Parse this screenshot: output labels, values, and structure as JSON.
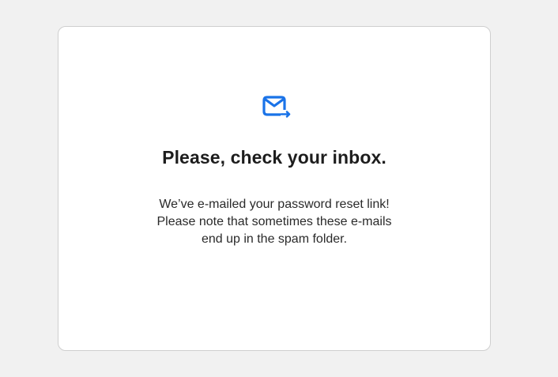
{
  "card": {
    "icon": "mail-forward-icon",
    "title": "Please, check your inbox.",
    "message_lines": [
      "We’ve e-mailed your password reset link!",
      "Please note that sometimes these e-mails",
      "end up in the spam folder."
    ]
  },
  "colors": {
    "background": "#f1f1f1",
    "card": "#ffffff",
    "accent": "#1a73e8",
    "text": "#1f1f1f"
  }
}
